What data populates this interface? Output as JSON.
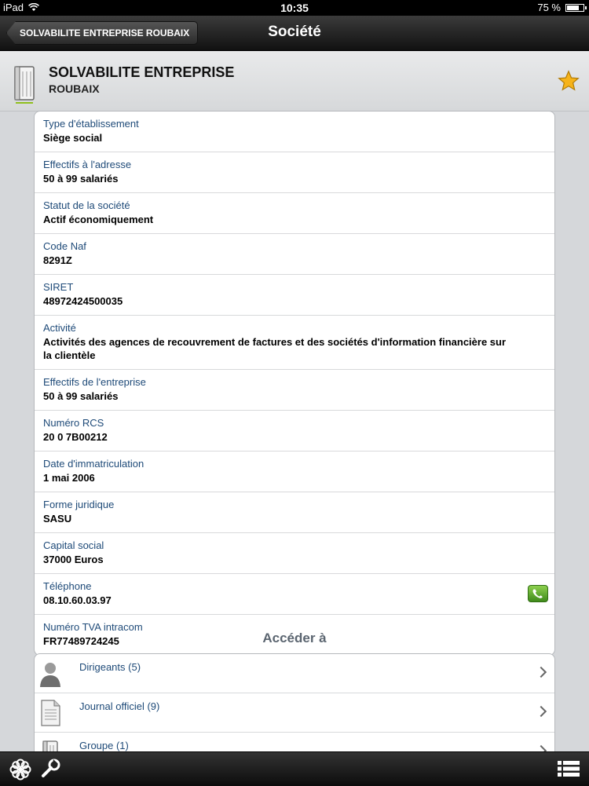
{
  "status_bar": {
    "device": "iPad",
    "time": "10:35",
    "battery": "75 %",
    "battery_level": 0.75
  },
  "nav": {
    "back_label": "SOLVABILITE ENTREPRISE ROUBAIX",
    "title": "Société"
  },
  "header": {
    "company_name": "SOLVABILITE ENTREPRISE",
    "company_city": "ROUBAIX",
    "icon": "building-icon",
    "favorite_icon": "star-icon",
    "accent_color": "#8fbf1d"
  },
  "details": [
    {
      "label": "Type d'établissement",
      "value": "Siège social"
    },
    {
      "label": "Effectifs à l'adresse",
      "value": "50 à 99 salariés"
    },
    {
      "label": "Statut de la société",
      "value": "Actif économiquement"
    },
    {
      "label": "Code Naf",
      "value": "8291Z"
    },
    {
      "label": "SIRET",
      "value": "48972424500035"
    },
    {
      "label": "Activité",
      "value": "Activités des agences de recouvrement de factures et des sociétés d'information financière sur la clientèle"
    },
    {
      "label": "Effectifs de l'entreprise",
      "value": "50 à 99 salariés"
    },
    {
      "label": "Numéro RCS",
      "value": "20 0 7B00212"
    },
    {
      "label": "Date d'immatriculation",
      "value": "1 mai 2006"
    },
    {
      "label": "Forme juridique",
      "value": "SASU"
    },
    {
      "label": "Capital social",
      "value": "37000 Euros"
    },
    {
      "label": "Téléphone",
      "value": "08.10.60.03.97"
    },
    {
      "label": "Numéro TVA intracom",
      "value": "FR77489724245"
    }
  ],
  "access": {
    "title": "Accéder à",
    "items": [
      {
        "label": "Dirigeants (5)",
        "icon": "person-icon"
      },
      {
        "label": "Journal officiel (9)",
        "icon": "document-icon"
      },
      {
        "label": "Groupe (1)",
        "icon": "building-icon"
      }
    ]
  },
  "toolbar": {
    "left_icons": [
      "flower-icon",
      "wrench-icon"
    ],
    "right_icon": "list-icon"
  }
}
